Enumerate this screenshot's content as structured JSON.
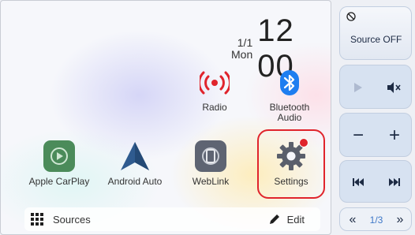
{
  "clock": {
    "date_top": "1/1",
    "date_bottom": "Mon",
    "time": "12 00"
  },
  "apps": [
    {
      "label": "Radio"
    },
    {
      "label": "Bluetooth Audio"
    },
    {
      "label": "Apple CarPlay"
    },
    {
      "label": "Android Auto"
    },
    {
      "label": "WebLink"
    },
    {
      "label": "Settings"
    }
  ],
  "bottombar": {
    "sources_label": "Sources",
    "edit_label": "Edit"
  },
  "side": {
    "source_label": "Source OFF",
    "minus": "−",
    "plus": "+",
    "page_indicator": "1/3",
    "prev_page": "«",
    "next_page": "»"
  },
  "colors": {
    "accent_red": "#e0242c",
    "bluetooth_blue": "#1e7ef0",
    "panel_blue": "#d7e2f1"
  }
}
